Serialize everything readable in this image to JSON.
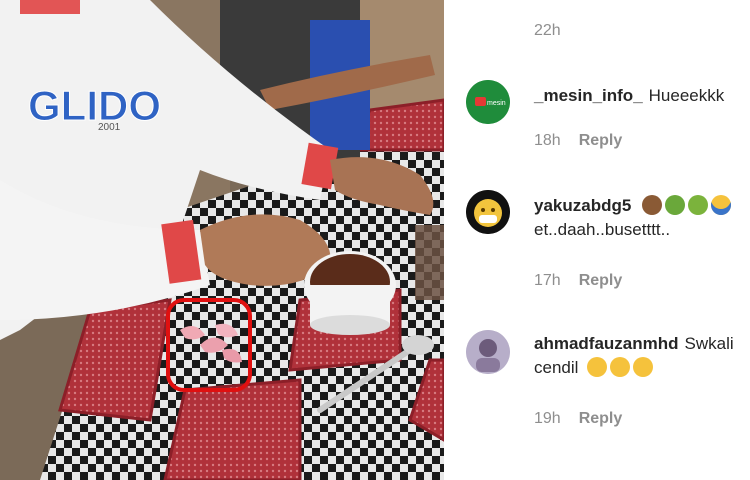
{
  "photo": {
    "shirt_text": "GLIDO",
    "shirt_subtext": "2001"
  },
  "first_time": "22h",
  "reply_label": "Reply",
  "comments": [
    {
      "username": "_mesin_info_",
      "text": "Hueeekkk",
      "time": "18h",
      "avatar_text": "mesin"
    },
    {
      "username": "yakuzabdg5",
      "text": "et..daah..busetttt..",
      "emojis": [
        "see-no-evil-monkey",
        "nauseated-face",
        "vomiting-face",
        "screaming-face"
      ],
      "time": "17h"
    },
    {
      "username": "ahmadfauzanmhd",
      "text_1": "Swkali",
      "text_2": "cendil",
      "emojis": [
        "laughing-face",
        "laughing-face",
        "laughing-face"
      ],
      "time": "19h"
    }
  ],
  "colors": {
    "highlight_box": "#e01010",
    "meta_text": "#8e8e8e"
  }
}
